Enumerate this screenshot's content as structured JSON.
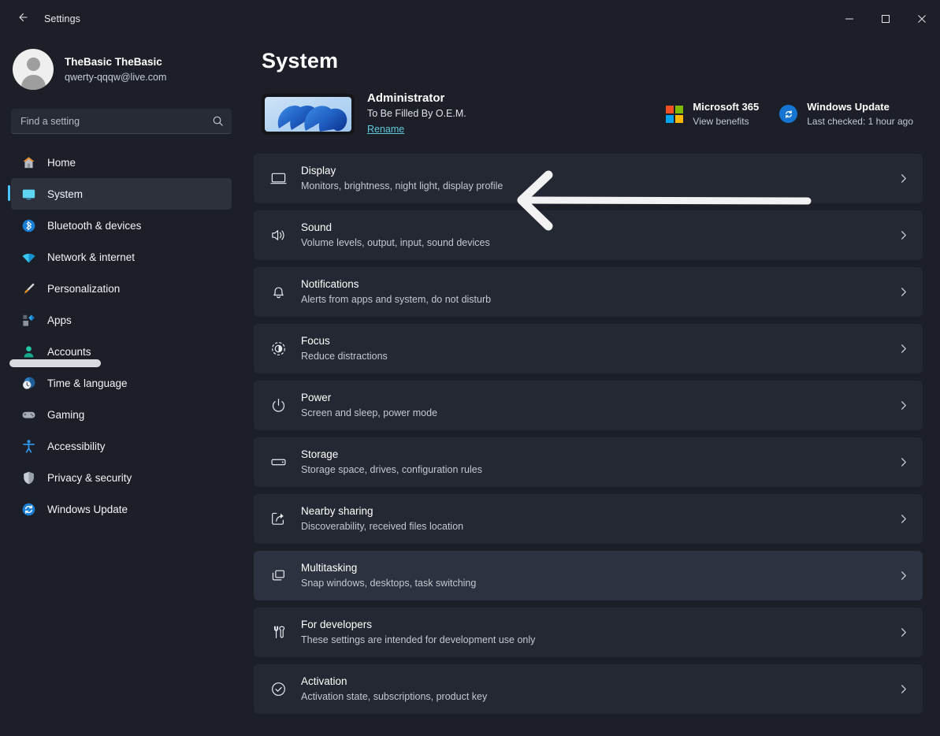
{
  "window": {
    "title": "Settings",
    "back_icon": "arrow-left-icon",
    "controls": {
      "minimize": "minimize-icon",
      "maximize": "maximize-icon",
      "close": "close-icon"
    }
  },
  "sidebar": {
    "account": {
      "name": "TheBasic TheBasic",
      "email": "qwerty-qqqw@live.com",
      "avatar": "user-avatar"
    },
    "search": {
      "placeholder": "Find a setting",
      "value": "",
      "icon": "search-icon"
    },
    "items": [
      {
        "label": "Home",
        "icon": "home-icon",
        "selected": false
      },
      {
        "label": "System",
        "icon": "system-monitor-icon",
        "selected": true
      },
      {
        "label": "Bluetooth & devices",
        "icon": "bluetooth-icon",
        "selected": false
      },
      {
        "label": "Network & internet",
        "icon": "wifi-icon",
        "selected": false
      },
      {
        "label": "Personalization",
        "icon": "paintbrush-icon",
        "selected": false
      },
      {
        "label": "Apps",
        "icon": "apps-icon",
        "selected": false
      },
      {
        "label": "Accounts",
        "icon": "account-person-icon",
        "selected": false
      },
      {
        "label": "Time & language",
        "icon": "clock-globe-icon",
        "selected": false
      },
      {
        "label": "Gaming",
        "icon": "gamepad-icon",
        "selected": false
      },
      {
        "label": "Accessibility",
        "icon": "accessibility-person-icon",
        "selected": false
      },
      {
        "label": "Privacy & security",
        "icon": "shield-icon",
        "selected": false
      },
      {
        "label": "Windows Update",
        "icon": "update-refresh-icon",
        "selected": false
      }
    ]
  },
  "main": {
    "page_title": "System",
    "device": {
      "name": "Administrator",
      "model": "To Be Filled By O.E.M.",
      "rename_label": "Rename",
      "thumbnail": "windows-bloom-wallpaper"
    },
    "header_cards": [
      {
        "title": "Microsoft 365",
        "subtitle": "View benefits",
        "icon": "microsoft-logo-icon"
      },
      {
        "title": "Windows Update",
        "subtitle": "Last checked: 1 hour ago",
        "icon": "update-refresh-icon"
      }
    ],
    "settings_rows": [
      {
        "title": "Display",
        "subtitle": "Monitors, brightness, night light, display profile",
        "icon": "monitor-icon",
        "chevron": "chevron-right-icon",
        "hover": false
      },
      {
        "title": "Sound",
        "subtitle": "Volume levels, output, input, sound devices",
        "icon": "speaker-icon",
        "chevron": "chevron-right-icon",
        "hover": false
      },
      {
        "title": "Notifications",
        "subtitle": "Alerts from apps and system, do not disturb",
        "icon": "bell-icon",
        "chevron": "chevron-right-icon",
        "hover": false
      },
      {
        "title": "Focus",
        "subtitle": "Reduce distractions",
        "icon": "focus-icon",
        "chevron": "chevron-right-icon",
        "hover": false
      },
      {
        "title": "Power",
        "subtitle": "Screen and sleep, power mode",
        "icon": "power-icon",
        "chevron": "chevron-right-icon",
        "hover": false
      },
      {
        "title": "Storage",
        "subtitle": "Storage space, drives, configuration rules",
        "icon": "storage-drive-icon",
        "chevron": "chevron-right-icon",
        "hover": false
      },
      {
        "title": "Nearby sharing",
        "subtitle": "Discoverability, received files location",
        "icon": "share-icon",
        "chevron": "chevron-right-icon",
        "hover": false
      },
      {
        "title": "Multitasking",
        "subtitle": "Snap windows, desktops, task switching",
        "icon": "multitasking-windows-icon",
        "chevron": "chevron-right-icon",
        "hover": true
      },
      {
        "title": "For developers",
        "subtitle": "These settings are intended for development use only",
        "icon": "developer-tools-icon",
        "chevron": "chevron-right-icon",
        "hover": false
      },
      {
        "title": "Activation",
        "subtitle": "Activation state, subscriptions, product key",
        "icon": "check-circle-icon",
        "chevron": "chevron-right-icon",
        "hover": false
      }
    ]
  },
  "annotation": {
    "type": "arrow-left-annotation",
    "target": "Display",
    "color": "#f2f2f2"
  },
  "colors": {
    "window_bg": "#1c1f27",
    "row_bg": "#242833",
    "row_hover_bg": "#2d3240",
    "accent": "#4cc2ff",
    "link": "#62c7de",
    "text_primary": "#ffffff",
    "text_secondary": "#c3c8d1"
  }
}
